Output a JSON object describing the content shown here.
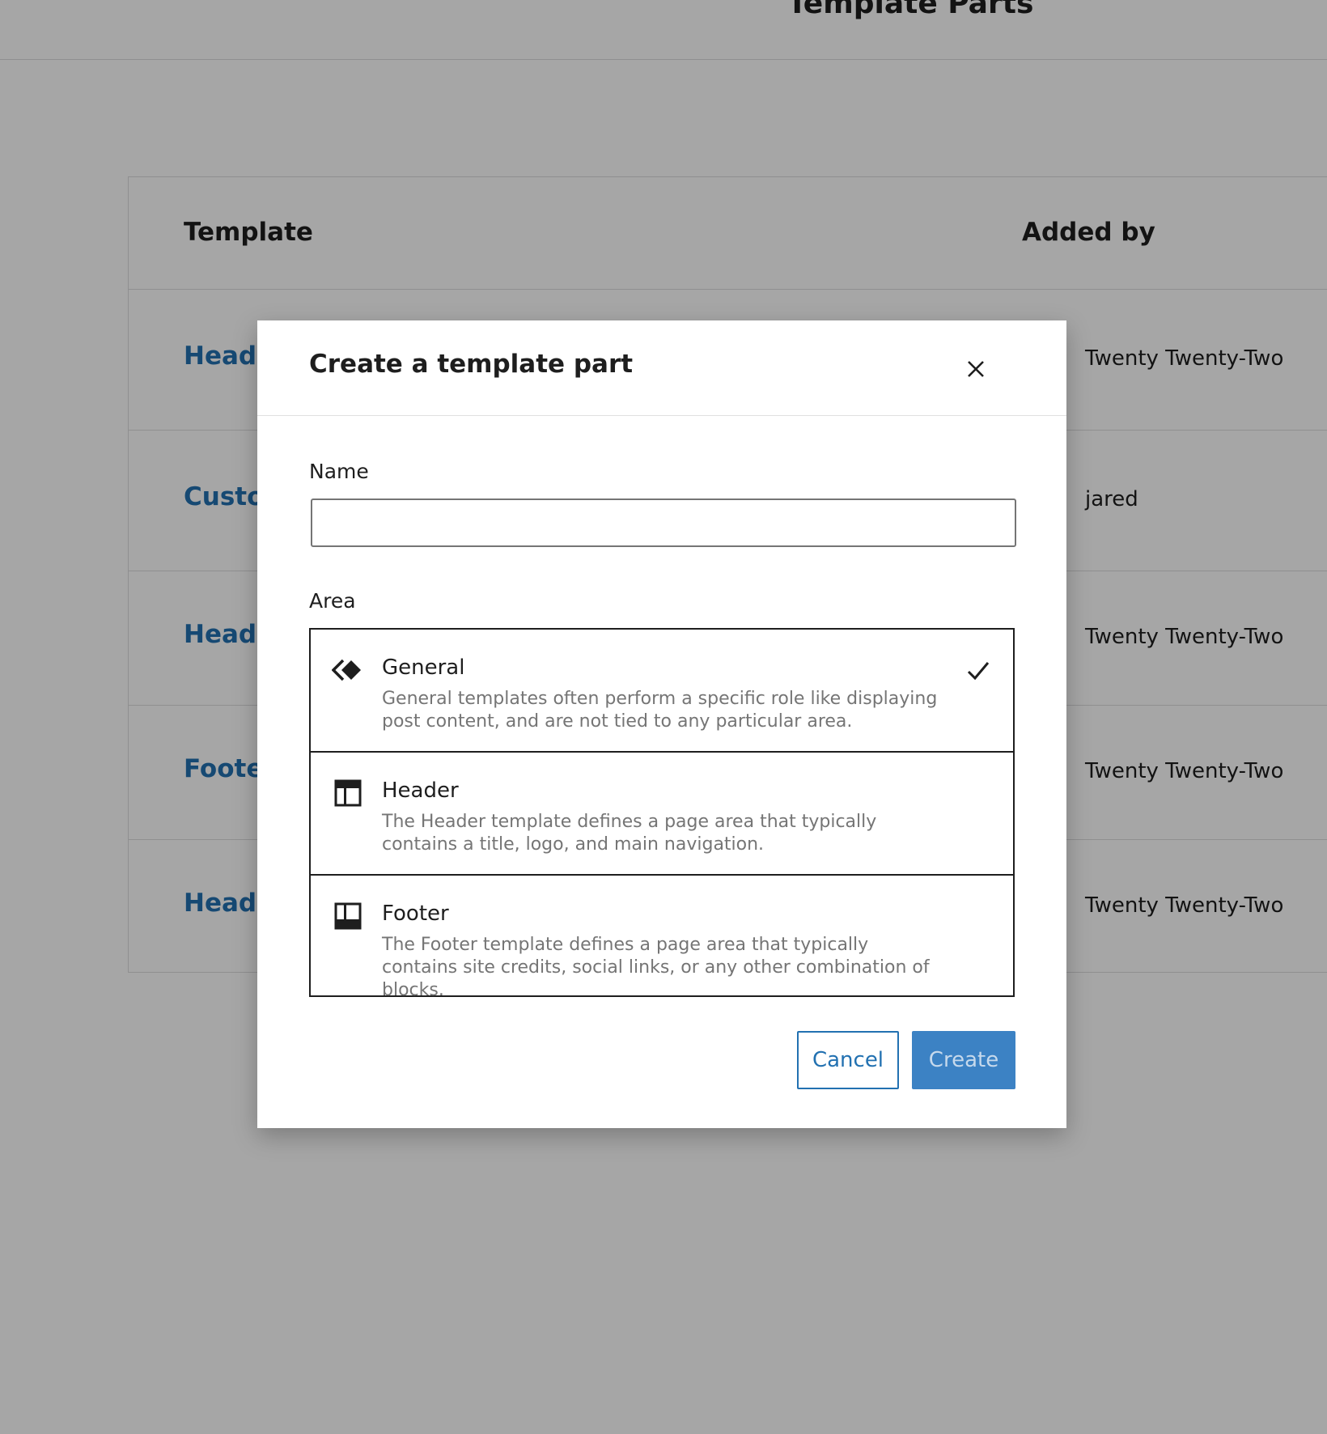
{
  "page": {
    "title": "Template Parts",
    "table": {
      "headers": {
        "template": "Template",
        "added_by": "Added by"
      },
      "rows": [
        {
          "name": "Header",
          "author": "Twenty Twenty-Two"
        },
        {
          "name": "Custom",
          "author": "jared"
        },
        {
          "name": "Header",
          "author": "Twenty Twenty-Two"
        },
        {
          "name": "Footer",
          "author": "Twenty Twenty-Two"
        },
        {
          "name": "Header",
          "author": "Twenty Twenty-Two"
        }
      ]
    }
  },
  "modal": {
    "title": "Create a template part",
    "close_icon": "close-icon",
    "name_label": "Name",
    "name_value": "",
    "name_placeholder": "",
    "area_label": "Area",
    "areas": [
      {
        "title": "General",
        "description": "General templates often perform a specific role like displaying post content, and are not tied to any particular area.",
        "icon": "general-block-icon",
        "selected": true
      },
      {
        "title": "Header",
        "description": "The Header template defines a page area that typically contains a title, logo, and main navigation.",
        "icon": "header-layout-icon",
        "selected": false
      },
      {
        "title": "Footer",
        "description": "The Footer template defines a page area that typically contains site credits, social links, or any other combination of blocks.",
        "icon": "footer-layout-icon",
        "selected": false
      }
    ],
    "cancel_label": "Cancel",
    "create_label": "Create"
  },
  "colors": {
    "accent": "#2271b1",
    "create_button": "#3c82c4",
    "overlay": "rgba(0,0,0,0.35)"
  }
}
